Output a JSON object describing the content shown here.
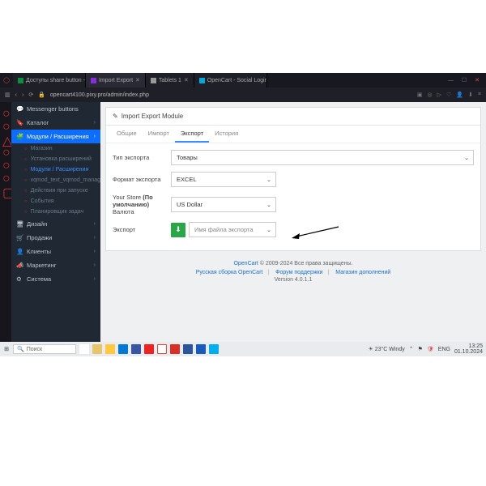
{
  "browser": {
    "tabs": [
      {
        "label": "Доступы share button - G…",
        "fav": "#0a8f3c"
      },
      {
        "label": "Import Export",
        "fav": "#8a2be2"
      },
      {
        "label": "Tablets 1",
        "fav": "#999"
      },
      {
        "label": "OpenCart - Social Login (f…",
        "fav": "#00a9e0"
      }
    ],
    "url": "opencart4100.pixy.pro/admin/index.php",
    "winctrl": {
      "min": "—",
      "max": "☐",
      "close": "✕"
    }
  },
  "sidebar": {
    "items": [
      {
        "icon": "💬",
        "label": "Messenger buttons"
      },
      {
        "icon": "🔖",
        "label": "Каталог",
        "chev": "›"
      },
      {
        "icon": "🧩",
        "label": "Модули / Расширения",
        "chev": "›",
        "active": true
      }
    ],
    "sub": [
      {
        "label": "Магазин"
      },
      {
        "label": "Установка расширений"
      },
      {
        "label": "Модули / Расширения",
        "active": true
      },
      {
        "label": "vqmod_text_vqmod_manager"
      },
      {
        "label": "Действия при запуске"
      },
      {
        "label": "События"
      },
      {
        "label": "Планировщик задач"
      }
    ],
    "items2": [
      {
        "icon": "🖥",
        "label": "Дизайн",
        "chev": "›"
      },
      {
        "icon": "📈",
        "label": "Продажи",
        "chev": "›"
      },
      {
        "icon": "👥",
        "label": "Клиенты",
        "chev": "›"
      },
      {
        "icon": "📣",
        "label": "Маркетинг",
        "chev": "›"
      },
      {
        "icon": "⚙",
        "label": "Система",
        "chev": "›"
      }
    ]
  },
  "panel": {
    "title": "Import Export Module",
    "tabs": [
      "Общие",
      "Импорт",
      "Экспорт",
      "История"
    ],
    "active_tab": 2,
    "fields": {
      "type_label": "Тип экспорта",
      "type_value": "Товары",
      "format_label": "Формат экспорта",
      "format_value": "EXCEL",
      "store_label_a": "Your Store ",
      "store_label_b": "(По умолчанию)",
      "store_label_c": " Валюта",
      "store_value": "US Dollar",
      "export_label": "Экспорт",
      "filename_placeholder": "Имя файла экспорта"
    }
  },
  "footer": {
    "line1a": "OpenCart",
    "line1b": " © 2009-2024 Все права защищены.",
    "links": [
      "Русская сборка OpenCart",
      "Форум поддержки",
      "Магазин дополнений"
    ],
    "version": "Version 4.0.1.1"
  },
  "taskbar": {
    "search": "Поиск",
    "weather": "23°C Windy",
    "lang": "ENG",
    "time": "13:25",
    "date": "01.10.2024"
  }
}
